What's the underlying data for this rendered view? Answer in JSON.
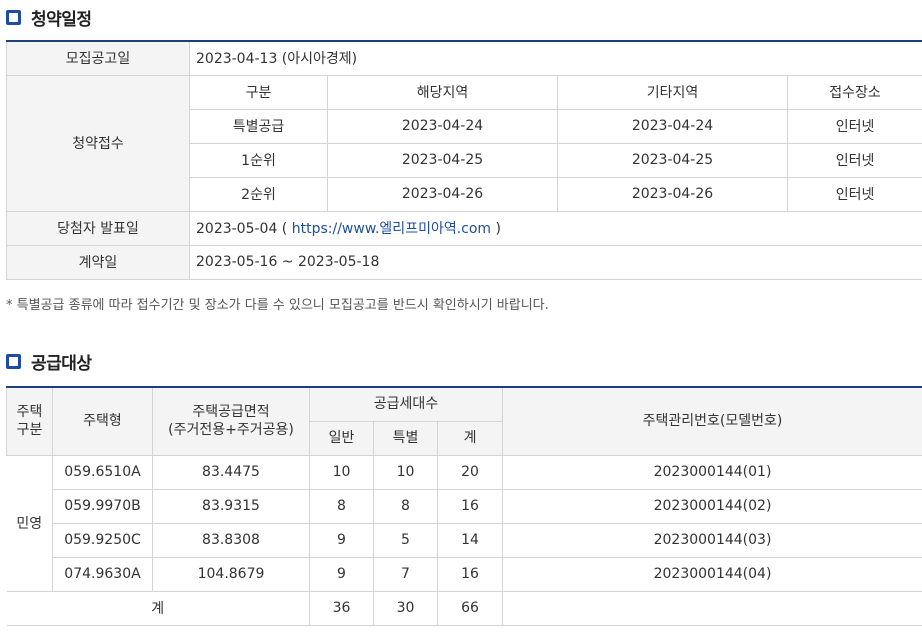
{
  "schedule": {
    "title": "청약일정",
    "notice_label": "모집공고일",
    "notice_value": "2023-04-13 (아시아경제)",
    "apply_label": "청약접수",
    "apply_headers": [
      "구분",
      "해당지역",
      "기타지역",
      "접수장소"
    ],
    "apply_rows": [
      [
        "특별공급",
        "2023-04-24",
        "2023-04-24",
        "인터넷"
      ],
      [
        "1순위",
        "2023-04-25",
        "2023-04-25",
        "인터넷"
      ],
      [
        "2순위",
        "2023-04-26",
        "2023-04-26",
        "인터넷"
      ]
    ],
    "winner_label": "당첨자 발표일",
    "winner_date": "2023-05-04 (",
    "winner_url": " https://www.엘리프미아역.com ",
    "winner_close": ")",
    "contract_label": "계약일",
    "contract_value": "2023-05-16 ~ 2023-05-18",
    "note": "* 특별공급 종류에 따라 접수기간 및 장소가 다를 수 있으니 모집공고를 반드시 확인하시기 바랍니다."
  },
  "supply": {
    "title": "공급대상",
    "headers": {
      "type_group": "주택\n구분",
      "type_group_line1": "주택",
      "type_group_line2": "구분",
      "housing_type": "주택형",
      "area_line1": "주택공급면적",
      "area_line2": "(주거전용+주거공용)",
      "units": "공급세대수",
      "general": "일반",
      "special": "특별",
      "total": "계",
      "mgmt": "주택관리번호(모델번호)"
    },
    "group_name": "민영",
    "rows": [
      [
        "059.6510A",
        "83.4475",
        "10",
        "10",
        "20",
        "2023000144(01)"
      ],
      [
        "059.9970B",
        "83.9315",
        "8",
        "8",
        "16",
        "2023000144(02)"
      ],
      [
        "059.9250C",
        "83.8308",
        "9",
        "5",
        "14",
        "2023000144(03)"
      ],
      [
        "074.9630A",
        "104.8679",
        "9",
        "7",
        "16",
        "2023000144(04)"
      ]
    ],
    "sum_label": "계",
    "sum_values": [
      "36",
      "30",
      "66"
    ]
  },
  "colors": {
    "accent": "#1e4aa8",
    "header_line": "#1e3f7c",
    "link": "#1f4e9c",
    "header_bg": "#f4f4f4"
  }
}
